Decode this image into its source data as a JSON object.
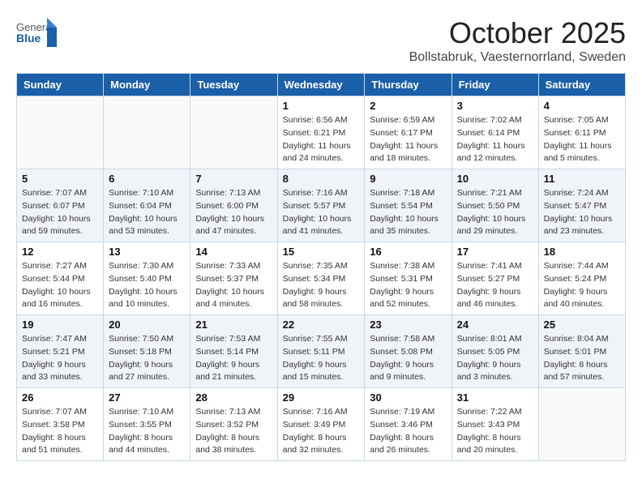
{
  "header": {
    "logo_general": "General",
    "logo_blue": "Blue",
    "title": "October 2025",
    "location": "Bollstabruk, Vaesternorrland, Sweden"
  },
  "days_of_week": [
    "Sunday",
    "Monday",
    "Tuesday",
    "Wednesday",
    "Thursday",
    "Friday",
    "Saturday"
  ],
  "weeks": [
    [
      {
        "day": "",
        "info": ""
      },
      {
        "day": "",
        "info": ""
      },
      {
        "day": "",
        "info": ""
      },
      {
        "day": "1",
        "info": "Sunrise: 6:56 AM\nSunset: 6:21 PM\nDaylight: 11 hours\nand 24 minutes."
      },
      {
        "day": "2",
        "info": "Sunrise: 6:59 AM\nSunset: 6:17 PM\nDaylight: 11 hours\nand 18 minutes."
      },
      {
        "day": "3",
        "info": "Sunrise: 7:02 AM\nSunset: 6:14 PM\nDaylight: 11 hours\nand 12 minutes."
      },
      {
        "day": "4",
        "info": "Sunrise: 7:05 AM\nSunset: 6:11 PM\nDaylight: 11 hours\nand 5 minutes."
      }
    ],
    [
      {
        "day": "5",
        "info": "Sunrise: 7:07 AM\nSunset: 6:07 PM\nDaylight: 10 hours\nand 59 minutes."
      },
      {
        "day": "6",
        "info": "Sunrise: 7:10 AM\nSunset: 6:04 PM\nDaylight: 10 hours\nand 53 minutes."
      },
      {
        "day": "7",
        "info": "Sunrise: 7:13 AM\nSunset: 6:00 PM\nDaylight: 10 hours\nand 47 minutes."
      },
      {
        "day": "8",
        "info": "Sunrise: 7:16 AM\nSunset: 5:57 PM\nDaylight: 10 hours\nand 41 minutes."
      },
      {
        "day": "9",
        "info": "Sunrise: 7:18 AM\nSunset: 5:54 PM\nDaylight: 10 hours\nand 35 minutes."
      },
      {
        "day": "10",
        "info": "Sunrise: 7:21 AM\nSunset: 5:50 PM\nDaylight: 10 hours\nand 29 minutes."
      },
      {
        "day": "11",
        "info": "Sunrise: 7:24 AM\nSunset: 5:47 PM\nDaylight: 10 hours\nand 23 minutes."
      }
    ],
    [
      {
        "day": "12",
        "info": "Sunrise: 7:27 AM\nSunset: 5:44 PM\nDaylight: 10 hours\nand 16 minutes."
      },
      {
        "day": "13",
        "info": "Sunrise: 7:30 AM\nSunset: 5:40 PM\nDaylight: 10 hours\nand 10 minutes."
      },
      {
        "day": "14",
        "info": "Sunrise: 7:33 AM\nSunset: 5:37 PM\nDaylight: 10 hours\nand 4 minutes."
      },
      {
        "day": "15",
        "info": "Sunrise: 7:35 AM\nSunset: 5:34 PM\nDaylight: 9 hours\nand 58 minutes."
      },
      {
        "day": "16",
        "info": "Sunrise: 7:38 AM\nSunset: 5:31 PM\nDaylight: 9 hours\nand 52 minutes."
      },
      {
        "day": "17",
        "info": "Sunrise: 7:41 AM\nSunset: 5:27 PM\nDaylight: 9 hours\nand 46 minutes."
      },
      {
        "day": "18",
        "info": "Sunrise: 7:44 AM\nSunset: 5:24 PM\nDaylight: 9 hours\nand 40 minutes."
      }
    ],
    [
      {
        "day": "19",
        "info": "Sunrise: 7:47 AM\nSunset: 5:21 PM\nDaylight: 9 hours\nand 33 minutes."
      },
      {
        "day": "20",
        "info": "Sunrise: 7:50 AM\nSunset: 5:18 PM\nDaylight: 9 hours\nand 27 minutes."
      },
      {
        "day": "21",
        "info": "Sunrise: 7:53 AM\nSunset: 5:14 PM\nDaylight: 9 hours\nand 21 minutes."
      },
      {
        "day": "22",
        "info": "Sunrise: 7:55 AM\nSunset: 5:11 PM\nDaylight: 9 hours\nand 15 minutes."
      },
      {
        "day": "23",
        "info": "Sunrise: 7:58 AM\nSunset: 5:08 PM\nDaylight: 9 hours\nand 9 minutes."
      },
      {
        "day": "24",
        "info": "Sunrise: 8:01 AM\nSunset: 5:05 PM\nDaylight: 9 hours\nand 3 minutes."
      },
      {
        "day": "25",
        "info": "Sunrise: 8:04 AM\nSunset: 5:01 PM\nDaylight: 8 hours\nand 57 minutes."
      }
    ],
    [
      {
        "day": "26",
        "info": "Sunrise: 7:07 AM\nSunset: 3:58 PM\nDaylight: 8 hours\nand 51 minutes."
      },
      {
        "day": "27",
        "info": "Sunrise: 7:10 AM\nSunset: 3:55 PM\nDaylight: 8 hours\nand 44 minutes."
      },
      {
        "day": "28",
        "info": "Sunrise: 7:13 AM\nSunset: 3:52 PM\nDaylight: 8 hours\nand 38 minutes."
      },
      {
        "day": "29",
        "info": "Sunrise: 7:16 AM\nSunset: 3:49 PM\nDaylight: 8 hours\nand 32 minutes."
      },
      {
        "day": "30",
        "info": "Sunrise: 7:19 AM\nSunset: 3:46 PM\nDaylight: 8 hours\nand 26 minutes."
      },
      {
        "day": "31",
        "info": "Sunrise: 7:22 AM\nSunset: 3:43 PM\nDaylight: 8 hours\nand 20 minutes."
      },
      {
        "day": "",
        "info": ""
      }
    ]
  ]
}
